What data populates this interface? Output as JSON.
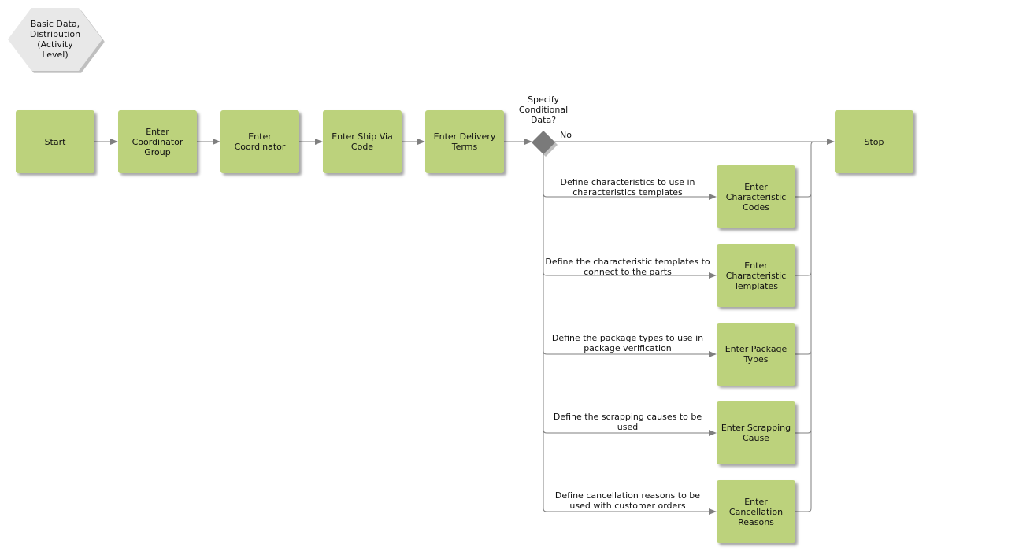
{
  "header": {
    "title": "Basic Data, Distribution (Activity Level)"
  },
  "main_flow": [
    {
      "id": "start",
      "label": "Start"
    },
    {
      "id": "enter-coordinator-group",
      "label": "Enter Coordinator Group"
    },
    {
      "id": "enter-coordinator",
      "label": "Enter Coordinator"
    },
    {
      "id": "enter-ship-via-code",
      "label": "Enter Ship Via Code"
    },
    {
      "id": "enter-delivery-terms",
      "label": "Enter Delivery Terms"
    }
  ],
  "decision": {
    "label": "Specify Conditional Data?",
    "no_label": "No"
  },
  "end": {
    "id": "stop",
    "label": "Stop"
  },
  "branches": [
    {
      "condition": "Define characteristics to use in characteristics templates",
      "activity": "Enter Characteristic Codes"
    },
    {
      "condition": "Define the characteristic templates to connect to the parts",
      "activity": "Enter Characteristic Templates"
    },
    {
      "condition": "Define the package types to use in package verification",
      "activity": "Enter Package Types"
    },
    {
      "condition": "Define the scrapping causes to be used",
      "activity": "Enter Scrapping Cause"
    },
    {
      "condition": "Define cancellation reasons to be used with customer orders",
      "activity": "Enter Cancellation Reasons"
    }
  ],
  "colors": {
    "activity_fill": "#bcd27c",
    "decision_fill": "#7a7a7a",
    "title_fill": "#e8e8e8",
    "connector": "#7f7f7f"
  }
}
